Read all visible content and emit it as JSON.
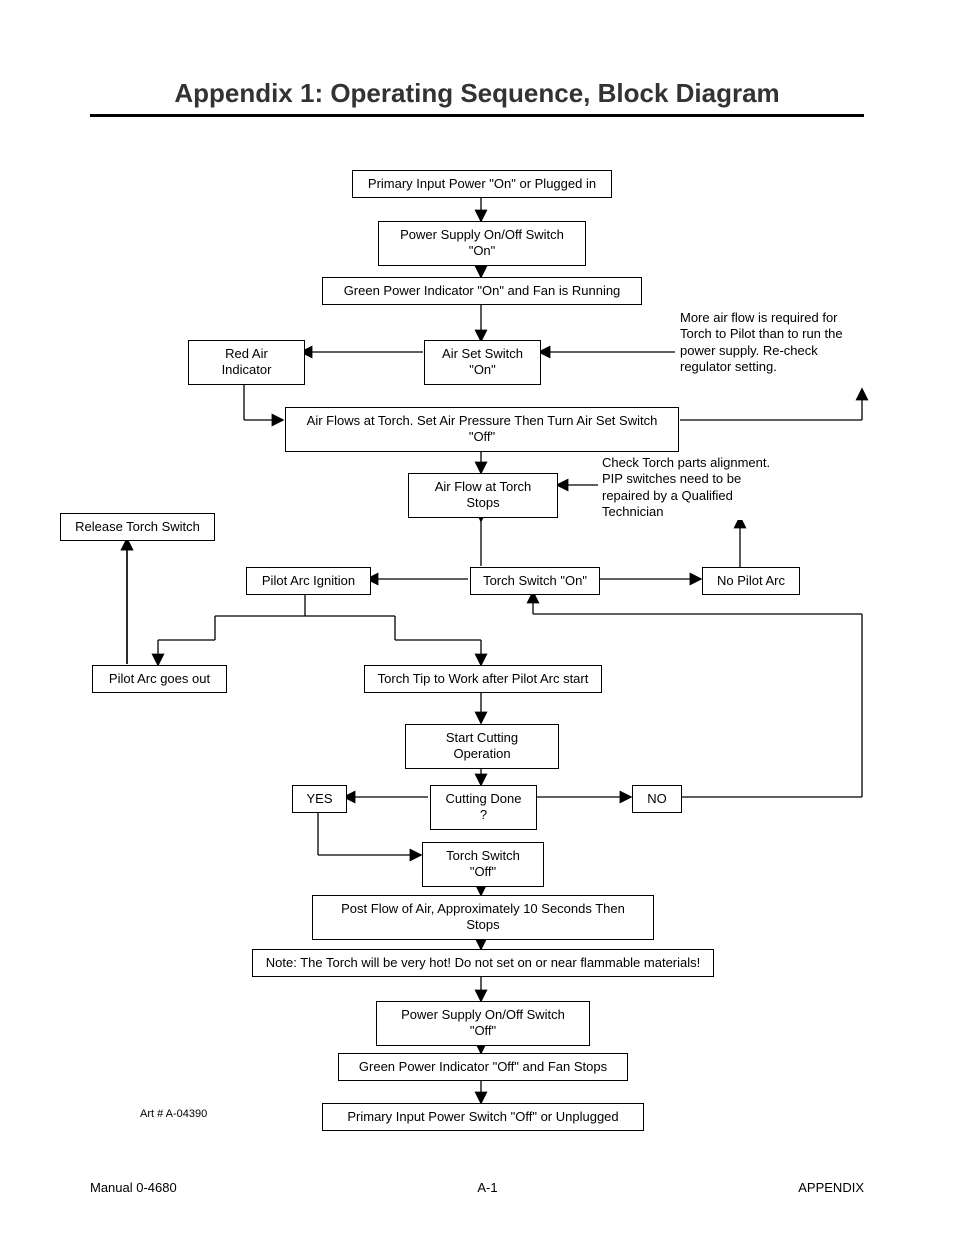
{
  "title": "Appendix 1:  Operating Sequence, Block Diagram",
  "nodes": {
    "n1": "Primary Input Power \"On\" or Plugged in",
    "n2": "Power Supply On/Off Switch \"On\"",
    "n3": "Green Power Indicator \"On\" and Fan is Running",
    "n4": "Air Set Switch \"On\"",
    "n4a": "Red Air Indicator",
    "n4b": "More air flow is required for Torch to Pilot than to run the power supply. Re-check regulator setting.",
    "n5": "Air Flows at Torch.  Set Air Pressure Then Turn Air Set Switch \"Off\"",
    "n6": "Air Flow at Torch Stops",
    "n6b": "Check Torch parts alignment.  PIP switches need to be repaired by a Qualified Technician",
    "rel": "Release Torch Switch",
    "n7": "Torch Switch \"On\"",
    "n7a": "Pilot Arc Ignition",
    "n7b": "No Pilot Arc",
    "n8": "Torch Tip to Work after Pilot Arc start",
    "n8a": "Pilot Arc goes out",
    "n9": "Start Cutting Operation",
    "n10": "Cutting Done ?",
    "yes": "YES",
    "no": "NO",
    "n11": "Torch Switch \"Off\"",
    "n12": "Post Flow of Air, Approximately 10 Seconds Then Stops",
    "n13": "Note:  The Torch will be very hot!  Do not set on or near flammable materials!",
    "n14": "Power Supply On/Off Switch \"Off\"",
    "n15": "Green Power Indicator \"Off\" and Fan Stops",
    "n16": "Primary Input Power Switch \"Off\" or Unplugged"
  },
  "art": "Art # A-04390",
  "footer": {
    "left": "Manual 0-4680",
    "center": "A-1",
    "right": "APPENDIX"
  },
  "chart_data": {
    "type": "flowchart",
    "description": "Operating sequence block diagram for plasma cutting torch power supply",
    "nodes": [
      {
        "id": "n1",
        "text": "Primary Input Power \"On\" or Plugged in"
      },
      {
        "id": "n2",
        "text": "Power Supply On/Off Switch \"On\""
      },
      {
        "id": "n3",
        "text": "Green Power Indicator \"On\" and Fan is Running"
      },
      {
        "id": "n4",
        "text": "Air Set Switch \"On\""
      },
      {
        "id": "n4a",
        "text": "Red Air Indicator"
      },
      {
        "id": "n4b",
        "text": "More air flow is required for Torch to Pilot than to run the power supply. Re-check regulator setting.",
        "type": "note"
      },
      {
        "id": "n5",
        "text": "Air Flows at Torch. Set Air Pressure Then Turn Air Set Switch \"Off\""
      },
      {
        "id": "n6",
        "text": "Air Flow at Torch Stops"
      },
      {
        "id": "n6b",
        "text": "Check Torch parts alignment. PIP switches need to be repaired by a Qualified Technician",
        "type": "note"
      },
      {
        "id": "rel",
        "text": "Release Torch Switch"
      },
      {
        "id": "n7",
        "text": "Torch Switch \"On\""
      },
      {
        "id": "n7a",
        "text": "Pilot Arc Ignition"
      },
      {
        "id": "n7b",
        "text": "No Pilot Arc"
      },
      {
        "id": "n8",
        "text": "Torch Tip to Work after Pilot Arc start"
      },
      {
        "id": "n8a",
        "text": "Pilot Arc goes out"
      },
      {
        "id": "n9",
        "text": "Start Cutting Operation"
      },
      {
        "id": "n10",
        "text": "Cutting Done ?",
        "type": "decision"
      },
      {
        "id": "n11",
        "text": "Torch Switch \"Off\""
      },
      {
        "id": "n12",
        "text": "Post Flow of Air, Approximately 10 Seconds Then Stops"
      },
      {
        "id": "n13",
        "text": "Note: The Torch will be very hot! Do not set on or near flammable materials!"
      },
      {
        "id": "n14",
        "text": "Power Supply On/Off Switch \"Off\""
      },
      {
        "id": "n15",
        "text": "Green Power Indicator \"Off\" and Fan Stops"
      },
      {
        "id": "n16",
        "text": "Primary Input Power Switch \"Off\" or Unplugged"
      }
    ],
    "edges": [
      {
        "from": "n1",
        "to": "n2"
      },
      {
        "from": "n2",
        "to": "n3"
      },
      {
        "from": "n3",
        "to": "n4"
      },
      {
        "from": "n4",
        "to": "n4a",
        "dir": "left"
      },
      {
        "from": "n4b",
        "to": "n4",
        "dir": "left"
      },
      {
        "from": "n4a",
        "to": "n5",
        "dir": "down-right"
      },
      {
        "from": "n5",
        "to": "n6"
      },
      {
        "from": "n6b",
        "to": "n6",
        "dir": "left"
      },
      {
        "from": "n6",
        "to": "n7"
      },
      {
        "from": "n7",
        "to": "n7a",
        "dir": "left"
      },
      {
        "from": "n7",
        "to": "n7b",
        "dir": "right"
      },
      {
        "from": "n7b",
        "to": "n6b",
        "dir": "up"
      },
      {
        "from": "n7a",
        "to": "n8",
        "dir": "down"
      },
      {
        "from": "n7a",
        "to": "n8a",
        "dir": "down-left"
      },
      {
        "from": "n8a",
        "to": "rel",
        "dir": "up"
      },
      {
        "from": "rel",
        "to": "n7a",
        "dir": "right-stop"
      },
      {
        "from": "n8",
        "to": "n9"
      },
      {
        "from": "n9",
        "to": "n10"
      },
      {
        "from": "n10",
        "to": "yes",
        "label": "YES",
        "dir": "left"
      },
      {
        "from": "n10",
        "to": "no",
        "label": "NO",
        "dir": "right"
      },
      {
        "from": "no",
        "to": "n7",
        "dir": "up-loop"
      },
      {
        "from": "yes",
        "to": "n11",
        "dir": "down-right"
      },
      {
        "from": "n11",
        "to": "n12"
      },
      {
        "from": "n12",
        "to": "n13"
      },
      {
        "from": "n13",
        "to": "n14"
      },
      {
        "from": "n14",
        "to": "n15"
      },
      {
        "from": "n15",
        "to": "n16"
      },
      {
        "from": "n5",
        "to": "n4b",
        "dir": "far-right-up",
        "note": "loop back to air-flow note"
      }
    ]
  }
}
